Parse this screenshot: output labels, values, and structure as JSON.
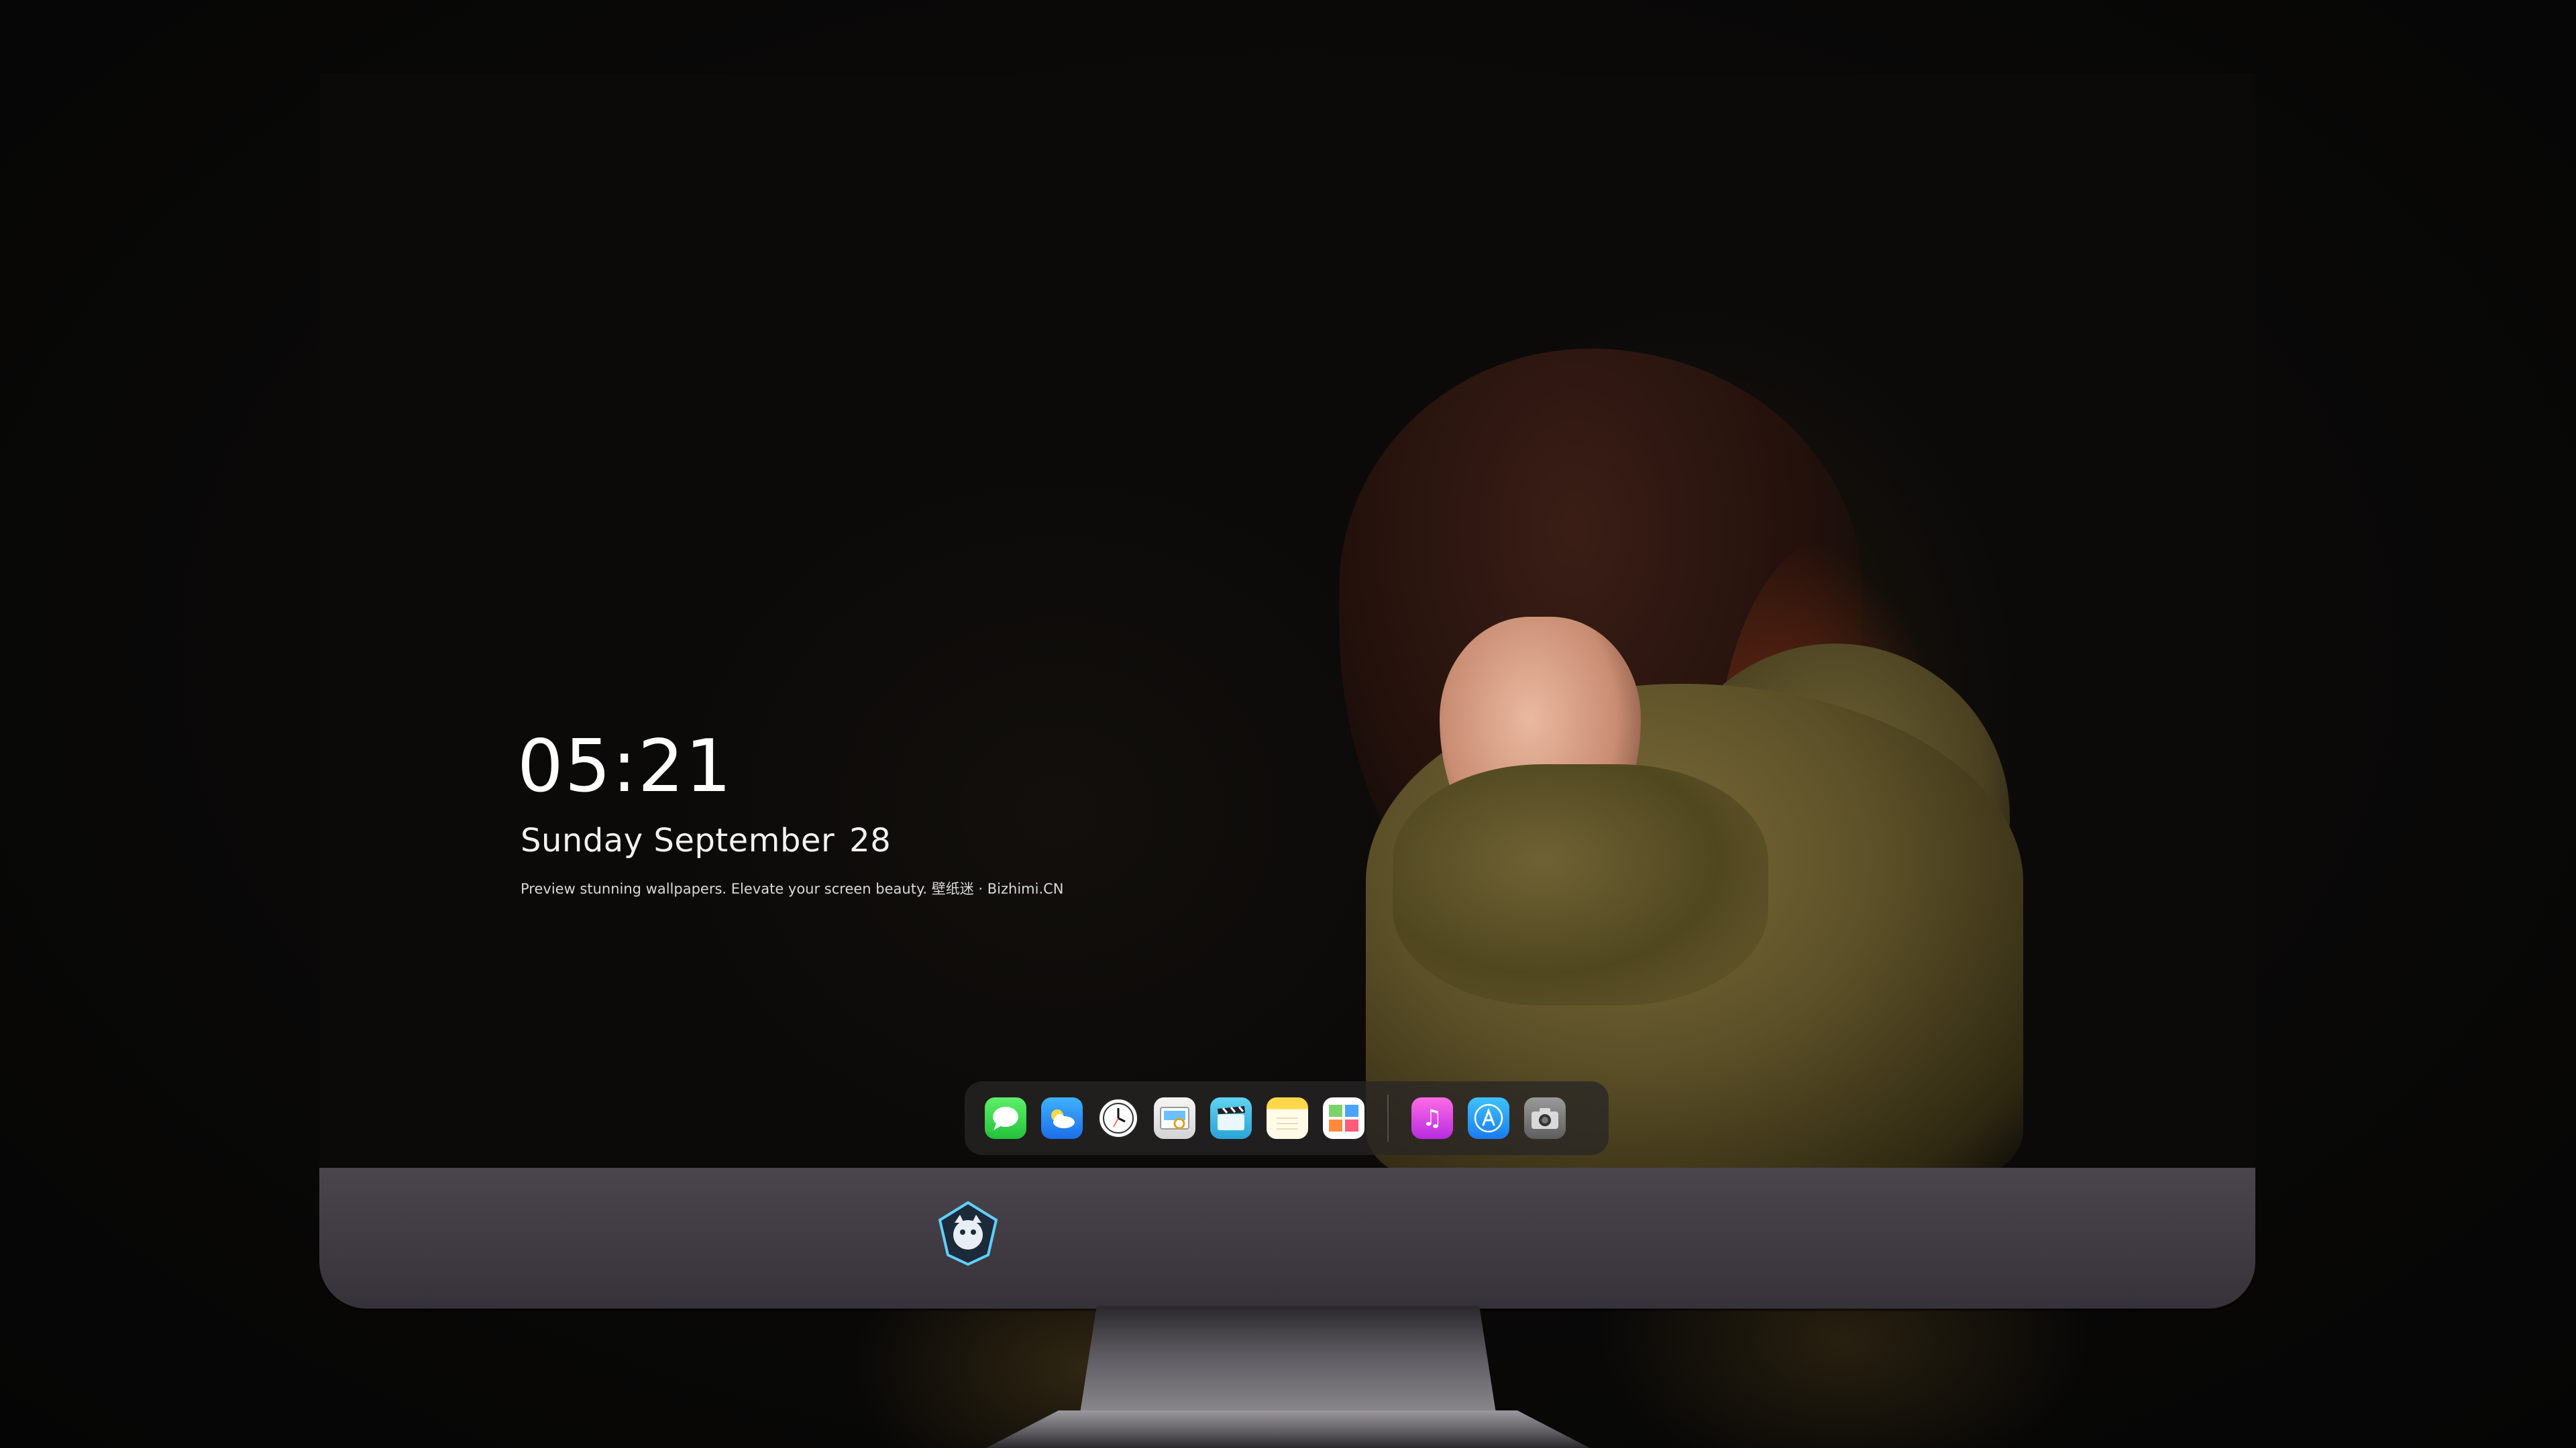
{
  "lock_screen": {
    "time": "05:21",
    "date_text": "Sunday September",
    "day_number": "28",
    "tagline": "Preview stunning wallpapers. Elevate your screen beauty. 壁纸迷 · Bizhimi.CN"
  },
  "dock": {
    "apps": [
      {
        "name": "messages",
        "icon": "messages-icon"
      },
      {
        "name": "weather",
        "icon": "weather-icon"
      },
      {
        "name": "clock",
        "icon": "clock-icon"
      },
      {
        "name": "preview",
        "icon": "preview-icon"
      },
      {
        "name": "clips",
        "icon": "clips-icon"
      },
      {
        "name": "notes",
        "icon": "notes-icon"
      },
      {
        "name": "photos",
        "icon": "photos-icon"
      },
      {
        "name": "music",
        "icon": "music-icon"
      },
      {
        "name": "app-store",
        "icon": "app-store-icon"
      },
      {
        "name": "camera",
        "icon": "camera-icon"
      }
    ],
    "glyphs": {
      "music": "♫",
      "app_store": "A"
    }
  },
  "colors": {
    "dock_background": "#282626",
    "bezel": "#433e45",
    "hoodie": "#6b5f32",
    "text": "#ffffff"
  },
  "wallpaper": {
    "subject": "woman-in-olive-hoodie"
  }
}
